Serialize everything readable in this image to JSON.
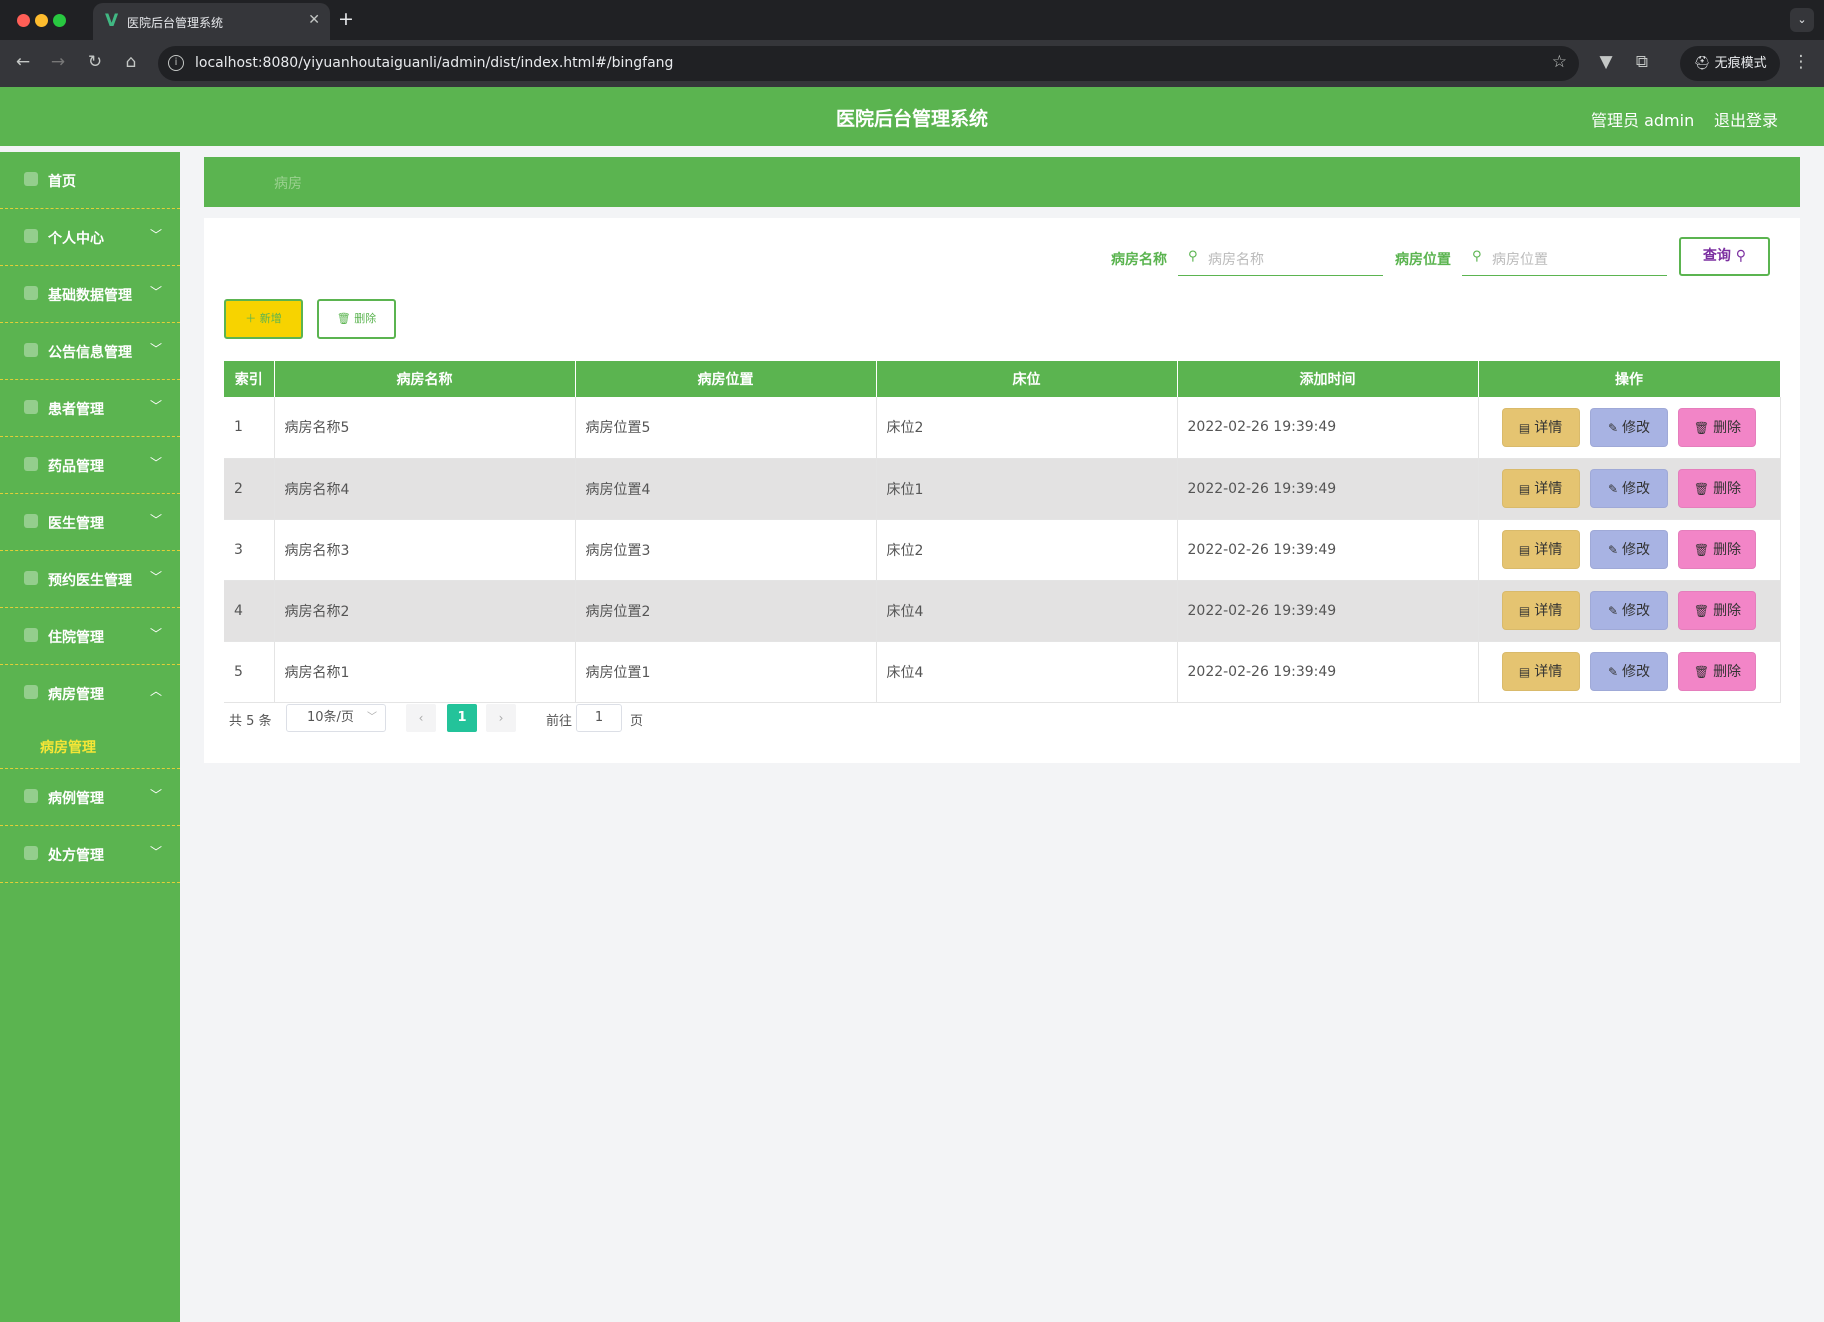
{
  "browser": {
    "tab_title": "医院后台管理系统",
    "url": "localhost:8080/yiyuanhoutaiguanli/admin/dist/index.html#/bingfang",
    "incognito_label": "无痕模式"
  },
  "header": {
    "title": "医院后台管理系统",
    "user": "管理员 admin",
    "logout": "退出登录"
  },
  "sidebar": {
    "items": [
      {
        "label": "首页",
        "icon": "home-icon"
      },
      {
        "label": "个人中心",
        "icon": "user-icon"
      },
      {
        "label": "基础数据管理",
        "icon": "list-icon"
      },
      {
        "label": "公告信息管理",
        "icon": "notice-icon"
      },
      {
        "label": "患者管理",
        "icon": "patient-icon"
      },
      {
        "label": "药品管理",
        "icon": "medicine-icon"
      },
      {
        "label": "医生管理",
        "icon": "doctor-icon"
      },
      {
        "label": "预约医生管理",
        "icon": "appointment-icon"
      },
      {
        "label": "住院管理",
        "icon": "hospital-icon"
      },
      {
        "label": "病房管理",
        "icon": "ward-icon",
        "sub": "病房管理"
      },
      {
        "label": "病例管理",
        "icon": "case-icon"
      },
      {
        "label": "处方管理",
        "icon": "prescription-icon"
      }
    ]
  },
  "breadcrumb": "病房",
  "search": {
    "name_label": "病房名称",
    "name_placeholder": "病房名称",
    "loc_label": "病房位置",
    "loc_placeholder": "病房位置",
    "query": "查询"
  },
  "toolbar": {
    "add": "新增",
    "delete": "删除"
  },
  "table": {
    "columns": [
      "索引",
      "病房名称",
      "病房位置",
      "床位",
      "添加时间",
      "操作"
    ],
    "rows": [
      [
        "1",
        "病房名称5",
        "病房位置5",
        "床位2",
        "2022-02-26 19:39:49"
      ],
      [
        "2",
        "病房名称4",
        "病房位置4",
        "床位1",
        "2022-02-26 19:39:49"
      ],
      [
        "3",
        "病房名称3",
        "病房位置3",
        "床位2",
        "2022-02-26 19:39:49"
      ],
      [
        "4",
        "病房名称2",
        "病房位置2",
        "床位4",
        "2022-02-26 19:39:49"
      ],
      [
        "5",
        "病房名称1",
        "病房位置1",
        "床位4",
        "2022-02-26 19:39:49"
      ]
    ],
    "ops": {
      "detail": "详情",
      "edit": "修改",
      "delete": "删除"
    }
  },
  "pagination": {
    "total": "共 5 条",
    "page_size": "10条/页",
    "current": "1",
    "goto_label": "前往",
    "goto_value": "1",
    "page_suffix": "页"
  },
  "colors": {
    "brand_green": "#5bb450",
    "accent_yellow": "#f7d300",
    "page_active": "#23c39a"
  }
}
